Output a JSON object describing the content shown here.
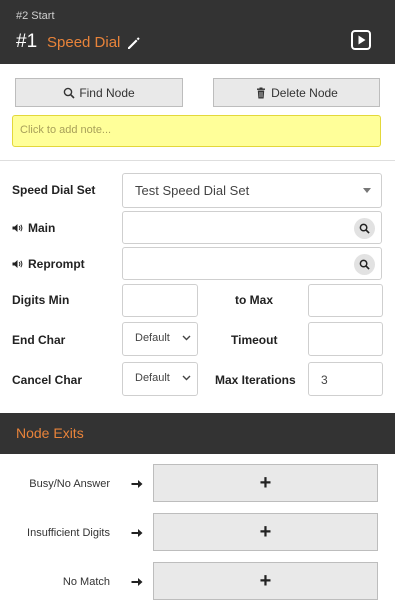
{
  "header": {
    "breadcrumb": "#2 Start",
    "node_number": "#1",
    "node_title": "Speed Dial"
  },
  "actions": {
    "find_node": "Find Node",
    "delete_node": "Delete Node"
  },
  "note": {
    "placeholder": "Click to add note..."
  },
  "form": {
    "speed_dial_set": {
      "label": "Speed Dial Set",
      "value": "Test Speed Dial Set"
    },
    "main": {
      "label": "Main",
      "value": ""
    },
    "reprompt": {
      "label": "Reprompt",
      "value": ""
    },
    "digits_min": {
      "label": "Digits Min",
      "value": ""
    },
    "to_max": {
      "label": "to Max",
      "value": ""
    },
    "end_char": {
      "label": "End Char",
      "value": "Default"
    },
    "timeout": {
      "label": "Timeout",
      "value": ""
    },
    "cancel_char": {
      "label": "Cancel Char",
      "value": "Default"
    },
    "max_iterations": {
      "label": "Max Iterations",
      "value": "3"
    }
  },
  "exits": {
    "title": "Node Exits",
    "items": [
      {
        "label": "Busy/No Answer",
        "button": "+"
      },
      {
        "label": "Insufficient Digits",
        "button": "+"
      },
      {
        "label": "No Match",
        "button": "+"
      }
    ]
  },
  "colors": {
    "header_bg": "#333333",
    "accent_orange": "#e8833a",
    "note_bg": "#ffff99",
    "button_bg": "#e9e9e9"
  },
  "icons": {
    "edit": "pencil-icon",
    "play": "play-icon",
    "find": "search-icon",
    "delete": "trash-icon",
    "audio": "speaker-icon",
    "arrow": "arrow-right-icon"
  }
}
